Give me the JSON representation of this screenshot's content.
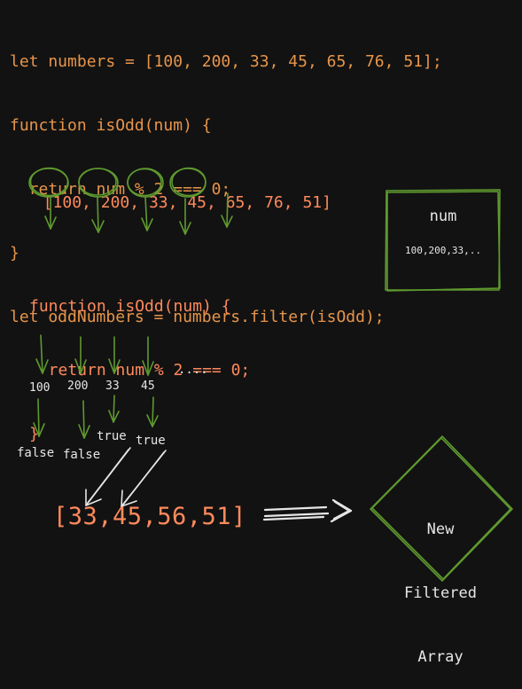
{
  "code_block": {
    "lines": [
      "let numbers = [100, 200, 33, 45, 65, 76, 51];",
      "function isOdd(num) {",
      "  return num % 2 === 0;",
      "}",
      "let oddNumbers = numbers.filter(isOdd);"
    ]
  },
  "array_row": {
    "open_bracket": "[",
    "items": [
      "100",
      "200",
      "33",
      "45",
      "65",
      "76",
      "51"
    ],
    "close_bracket": "]"
  },
  "function_block": {
    "lines": [
      "function isOdd(num) {",
      "  return num % 2 === 0;",
      "}"
    ]
  },
  "num_box": {
    "title": "num",
    "value": "100,200,33,.."
  },
  "iteration_values": [
    "100",
    "200",
    "33",
    "45"
  ],
  "ellipsis": "....",
  "results": {
    "false_1": "false",
    "false_2": "false",
    "true_1": "true",
    "true_2": "true"
  },
  "result_array": "[33,45,56,51]",
  "new_array_label": [
    "New",
    "Filtered",
    "Array"
  ],
  "colors": {
    "background": "#121212",
    "code_orange": "#e8954a",
    "array_salmon": "#ff8a5c",
    "sketch_green": "#5f9a2f",
    "label_white": "#e6e6e6"
  }
}
